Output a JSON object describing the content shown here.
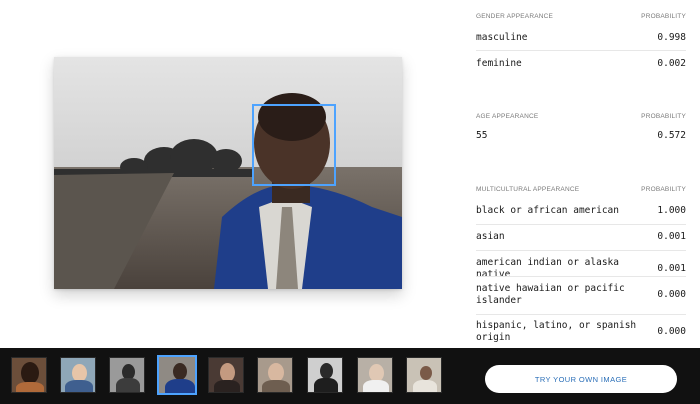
{
  "image": {
    "subject_icon": "portrait-photo",
    "face_box_color": "#4da3ff"
  },
  "gender": {
    "header": "GENDER APPEARANCE",
    "prob_header": "PROBABILITY",
    "rows": [
      {
        "label": "masculine",
        "value": "0.998"
      },
      {
        "label": "feminine",
        "value": "0.002"
      }
    ]
  },
  "age": {
    "header": "AGE APPEARANCE",
    "prob_header": "PROBABILITY",
    "rows": [
      {
        "label": "55",
        "value": "0.572"
      }
    ]
  },
  "multicultural": {
    "header": "MULTICULTURAL APPEARANCE",
    "prob_header": "PROBABILITY",
    "rows": [
      {
        "label": "black or african american",
        "value": "1.000"
      },
      {
        "label": "asian",
        "value": "0.001"
      },
      {
        "label": "american indian or alaska native",
        "value": "0.001"
      },
      {
        "label": "native hawaiian or pacific islander",
        "value": "0.000"
      },
      {
        "label": "hispanic, latino, or spanish origin",
        "value": "0.000"
      }
    ]
  },
  "thumbnails": {
    "selected_index": 3,
    "count": 9
  },
  "try_button": {
    "label": "TRY YOUR OWN IMAGE"
  },
  "colors": {
    "accent": "#4da3ff",
    "strip_bg": "#111111",
    "button_text": "#2b6fb8"
  }
}
